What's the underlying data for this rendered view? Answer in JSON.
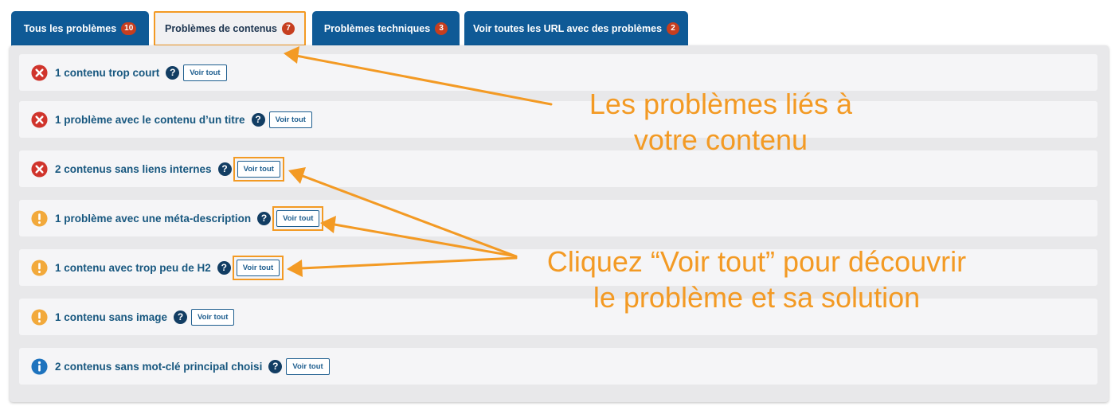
{
  "tabs": [
    {
      "label": "Tous les problèmes",
      "count": "10",
      "active": false
    },
    {
      "label": "Problèmes de contenus",
      "count": "7",
      "active": true
    },
    {
      "label": "Problèmes techniques",
      "count": "3",
      "active": false
    },
    {
      "label": "Voir toutes les URL avec des problèmes",
      "count": "2",
      "active": false
    }
  ],
  "rows": [
    {
      "status": "error",
      "label": "1 contenu trop court",
      "button": "Voir tout"
    },
    {
      "status": "error",
      "label": "1 problème avec le contenu d’un titre",
      "button": "Voir tout"
    },
    {
      "status": "error",
      "label": "2 contenus sans liens internes",
      "button": "Voir tout"
    },
    {
      "status": "warning",
      "label": "1 problème avec une méta-description",
      "button": "Voir tout"
    },
    {
      "status": "warning",
      "label": "1 contenu avec trop peu de H2",
      "button": "Voir tout"
    },
    {
      "status": "warning",
      "label": "1 contenu sans image",
      "button": "Voir tout"
    },
    {
      "status": "info",
      "label": "2 contenus sans mot-clé principal choisi",
      "button": "Voir tout"
    }
  ],
  "help_glyph": "?",
  "annotations": {
    "content_line1": "Les problèmes liés à",
    "content_line2": "votre contenu",
    "cta_line1": "Cliquez “Voir tout” pour découvrir",
    "cta_line2": "le problème et sa solution"
  },
  "colors": {
    "tab_bg": "#0f5a96",
    "badge": "#c63e1f",
    "accent": "#f39a24",
    "error": "#d0342c",
    "warning": "#f2a93b",
    "info": "#1e73be",
    "label": "#17577f"
  }
}
